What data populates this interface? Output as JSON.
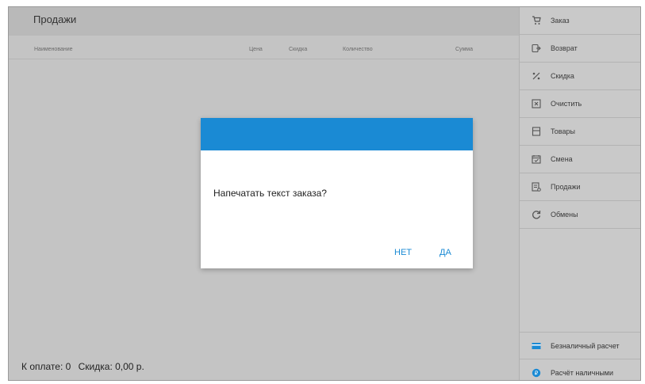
{
  "sales": {
    "title": "Продажи",
    "columns": {
      "name": "Наименование",
      "price": "Цена",
      "discount": "Скидка",
      "quantity": "Количество",
      "sum": "Сумма"
    },
    "summary": {
      "to_pay": "К оплате: 0",
      "discount": "Скидка: 0,00 р."
    }
  },
  "sidebar": {
    "items": [
      {
        "label": "Заказ",
        "icon": "cart-icon"
      },
      {
        "label": "Возврат",
        "icon": "return-icon"
      },
      {
        "label": "Скидка",
        "icon": "percent-icon"
      },
      {
        "label": "Очистить",
        "icon": "clear-icon"
      },
      {
        "label": "Товары",
        "icon": "products-icon"
      },
      {
        "label": "Смена",
        "icon": "shift-calendar-icon"
      },
      {
        "label": "Продажи",
        "icon": "sales-report-icon"
      },
      {
        "label": "Обмены",
        "icon": "sync-icon"
      }
    ],
    "payments": {
      "card": {
        "label": "Безналичный расчет",
        "icon": "credit-card-icon"
      },
      "cash": {
        "label": "Расчёт наличными",
        "icon": "cash-icon"
      }
    }
  },
  "dialog": {
    "message": "Напечатать текст заказа?",
    "no_label": "НЕТ",
    "yes_label": "ДА"
  },
  "colors": {
    "accent": "#1a8ad4",
    "overlay_panel": "#c4c4c4",
    "sidebar": "#c9c9c9"
  }
}
